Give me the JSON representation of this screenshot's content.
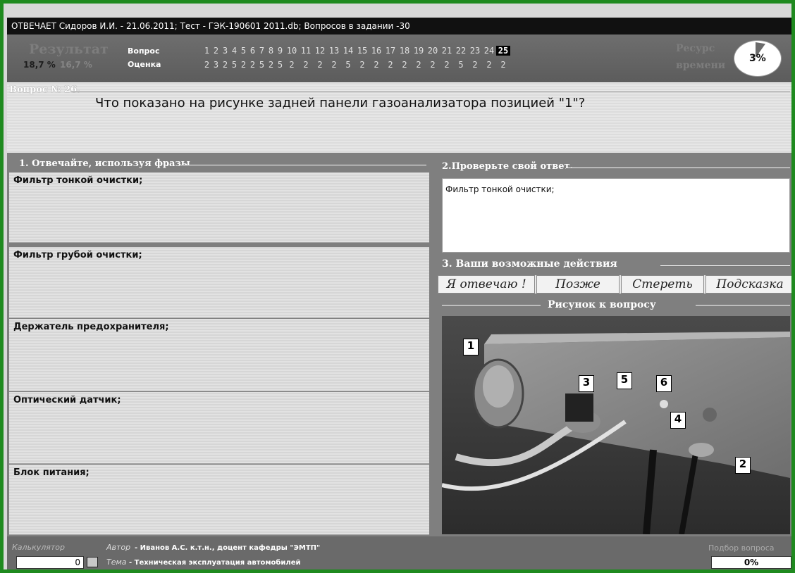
{
  "title_bar": "ОТВЕЧАЕТ Сидоров И.И. - 21.06.2011; Тест - ГЭК-190601 2011.db; Вопросов в задании -30",
  "header": {
    "result_word": "Результат",
    "result_percent": "18,7 %",
    "faint_percent": "16,7 %",
    "question_label": "Вопрос",
    "grade_label": "Оценка",
    "question_numbers": [
      "1",
      "2",
      "3",
      "4",
      "5",
      "6",
      "7",
      "8",
      "9",
      "10",
      "11",
      "12",
      "13",
      "14",
      "15",
      "16",
      "17",
      "18",
      "19",
      "20",
      "21",
      "22",
      "23",
      "24",
      "25"
    ],
    "grades": [
      "2",
      "3",
      "2",
      "5",
      "2",
      "2",
      "5",
      "2",
      "5",
      "2",
      "2",
      "2",
      "2",
      "5",
      "2",
      "2",
      "2",
      "2",
      "2",
      "2",
      "2",
      "5",
      "2",
      "2",
      "2"
    ],
    "current_question_index": 24,
    "resource_word": "Ресурс",
    "time_word": "времени",
    "time_percent": "3%",
    "time_fraction": 0.03
  },
  "question": {
    "group_title": "Вопрос № 26.",
    "text": "Что показано на рисунке задней панели газоанализатора  позицией \"1\"?"
  },
  "phrases": {
    "group_title": "1. Отвечайте, используя фразы",
    "items": [
      "Фильтр тонкой очистки;",
      "Фильтр грубой очистки;",
      "Держатель предохранителя;",
      "Оптический датчик;",
      "Блок питания;"
    ]
  },
  "check": {
    "group_title": "2.Проверьте свой ответ.",
    "answer": "Фильтр тонкой очистки;"
  },
  "actions": {
    "group_title": "3. Ваши возможные действия",
    "answer_btn": "Я отвечаю !",
    "later_btn": "Позже",
    "erase_btn": "Стереть",
    "hint_btn": "Подсказка"
  },
  "picture": {
    "title": "Рисунок к вопросу",
    "labels": [
      "1",
      "2",
      "3",
      "4",
      "5",
      "6"
    ]
  },
  "footer": {
    "calc_label": "Калькулятор",
    "calc_value": "0",
    "author_label": "Автор",
    "author_text": "- Иванов А.С. к.т.н., доцент кафедры \"ЭМТП\"",
    "topic_label": "Тема",
    "topic_text": "- Техническая эксплуатация автомобилей",
    "selection_label": "Подбор вопроса",
    "selection_percent": "0%"
  },
  "colors": {
    "frame": "#1f8a1f",
    "header": "#606060",
    "answer_bg": "#ffffff"
  }
}
